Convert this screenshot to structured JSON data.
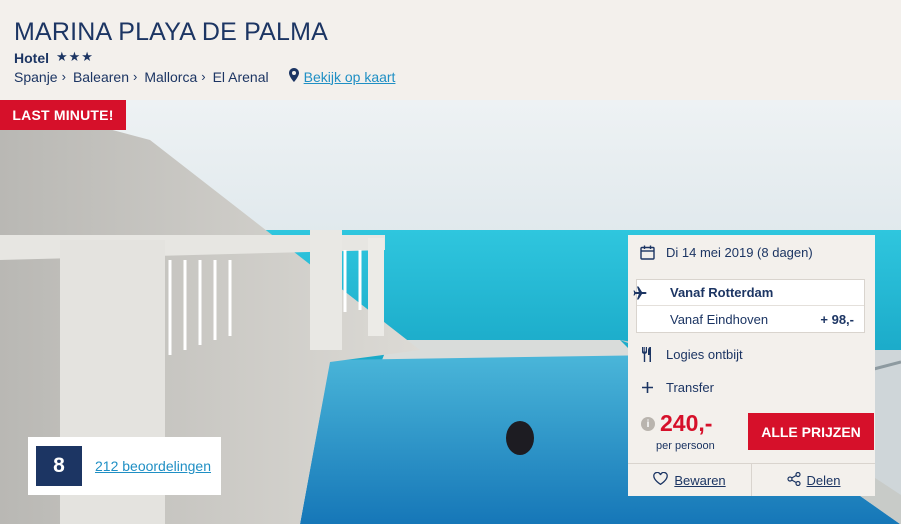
{
  "hotel": {
    "title": "MARINA PLAYA DE PALMA",
    "type": "Hotel",
    "stars": "★★★"
  },
  "breadcrumb": {
    "items": [
      "Spanje",
      "Balearen",
      "Mallorca",
      "El Arenal"
    ],
    "separator": "›",
    "map_link": "Bekijk op kaart"
  },
  "badge": {
    "label": "LAST MINUTE!"
  },
  "rating": {
    "score": "8",
    "reviews_link": "212 beoordelingen"
  },
  "booking": {
    "date": "Di 14 mei 2019 (8 dagen)",
    "flights": [
      {
        "name": "Vanaf Rotterdam",
        "extra": ""
      },
      {
        "name": "Vanaf Eindhoven",
        "extra": "+ 98,-"
      }
    ],
    "board": "Logies ontbijt",
    "transfer": "Transfer",
    "price": "240,-",
    "price_sub": "per persoon",
    "cta": "ALLE PRIJZEN",
    "save_label": "Bewaren",
    "share_label": "Delen"
  },
  "colors": {
    "brand_navy": "#1c3563",
    "accent_red": "#d6102a",
    "link_blue": "#1f8fc4",
    "panel_bg": "#f3f0ec"
  }
}
